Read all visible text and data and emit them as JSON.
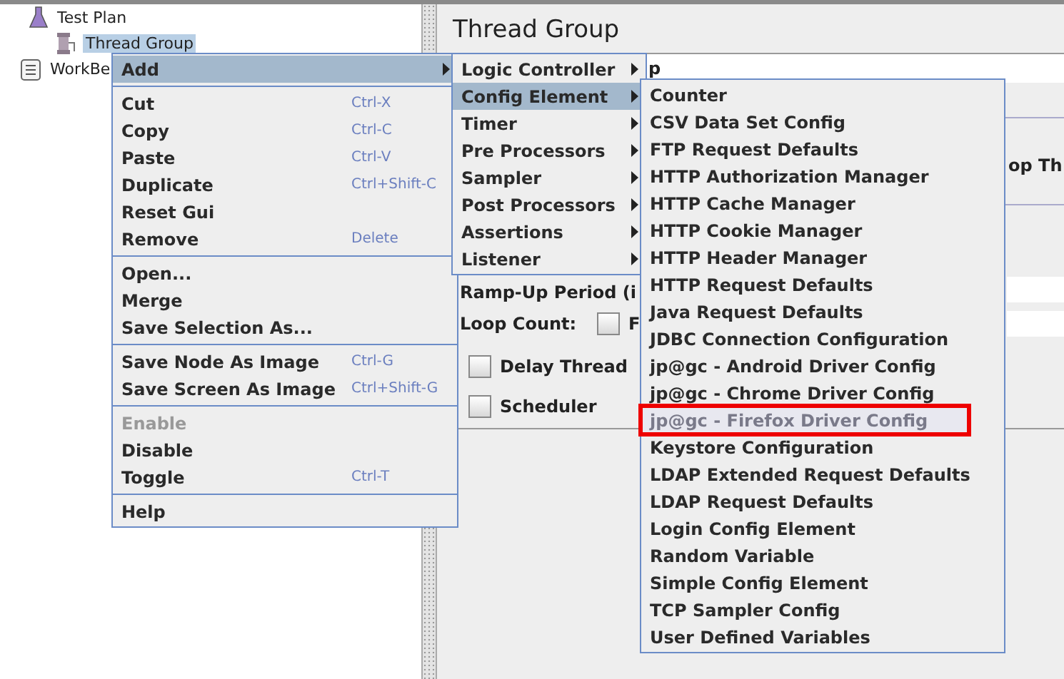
{
  "tree": {
    "items": [
      {
        "label": "Test Plan",
        "selected": false,
        "children": [
          {
            "label": "Thread Group",
            "selected": true
          }
        ]
      },
      {
        "label": "WorkBe",
        "selected": false
      }
    ]
  },
  "panel": {
    "title": "Thread Group",
    "name_value": "p",
    "action_text": "op Th",
    "rampup_label": "Ramp-Up Period (i",
    "loop_label": "Loop Count:",
    "forever": {
      "label": "F",
      "checked": false
    },
    "delay": {
      "label": "Delay Thread",
      "checked": false
    },
    "scheduler": {
      "label": "Scheduler",
      "checked": false
    }
  },
  "context_menu": {
    "items": [
      {
        "kind": "item",
        "label": "Add",
        "submenu": true,
        "selected": true,
        "disabled": false
      },
      {
        "kind": "separator"
      },
      {
        "kind": "item",
        "label": "Cut",
        "shortcut": "Ctrl-X",
        "submenu": false,
        "selected": false,
        "disabled": false
      },
      {
        "kind": "item",
        "label": "Copy",
        "shortcut": "Ctrl-C",
        "submenu": false,
        "selected": false,
        "disabled": false
      },
      {
        "kind": "item",
        "label": "Paste",
        "shortcut": "Ctrl-V",
        "submenu": false,
        "selected": false,
        "disabled": false
      },
      {
        "kind": "item",
        "label": "Duplicate",
        "shortcut": "Ctrl+Shift-C",
        "submenu": false,
        "selected": false,
        "disabled": false
      },
      {
        "kind": "item",
        "label": "Reset Gui",
        "submenu": false,
        "selected": false,
        "disabled": false
      },
      {
        "kind": "item",
        "label": "Remove",
        "shortcut": "Delete",
        "submenu": false,
        "selected": false,
        "disabled": false
      },
      {
        "kind": "separator"
      },
      {
        "kind": "item",
        "label": "Open...",
        "submenu": false,
        "selected": false,
        "disabled": false
      },
      {
        "kind": "item",
        "label": "Merge",
        "submenu": false,
        "selected": false,
        "disabled": false
      },
      {
        "kind": "item",
        "label": "Save Selection As...",
        "submenu": false,
        "selected": false,
        "disabled": false
      },
      {
        "kind": "separator"
      },
      {
        "kind": "item",
        "label": "Save Node As Image",
        "shortcut": "Ctrl-G",
        "submenu": false,
        "selected": false,
        "disabled": false
      },
      {
        "kind": "item",
        "label": "Save Screen As Image",
        "shortcut": "Ctrl+Shift-G",
        "submenu": false,
        "selected": false,
        "disabled": false
      },
      {
        "kind": "separator"
      },
      {
        "kind": "item",
        "label": "Enable",
        "submenu": false,
        "selected": false,
        "disabled": true
      },
      {
        "kind": "item",
        "label": "Disable",
        "submenu": false,
        "selected": false,
        "disabled": false
      },
      {
        "kind": "item",
        "label": "Toggle",
        "shortcut": "Ctrl-T",
        "submenu": false,
        "selected": false,
        "disabled": false
      },
      {
        "kind": "separator"
      },
      {
        "kind": "item",
        "label": "Help",
        "submenu": false,
        "selected": false,
        "disabled": false
      }
    ]
  },
  "add_menu": {
    "items": [
      {
        "label": "Logic Controller",
        "selected": false
      },
      {
        "label": "Config Element",
        "selected": true
      },
      {
        "label": "Timer",
        "selected": false
      },
      {
        "label": "Pre Processors",
        "selected": false
      },
      {
        "label": "Sampler",
        "selected": false
      },
      {
        "label": "Post Processors",
        "selected": false
      },
      {
        "label": "Assertions",
        "selected": false
      },
      {
        "label": "Listener",
        "selected": false
      }
    ]
  },
  "config_menu": {
    "items": [
      {
        "label": "Counter",
        "disabled": false,
        "annotated": false
      },
      {
        "label": "CSV Data Set Config",
        "disabled": false,
        "annotated": false
      },
      {
        "label": "FTP Request Defaults",
        "disabled": false,
        "annotated": false
      },
      {
        "label": "HTTP Authorization Manager",
        "disabled": false,
        "annotated": false
      },
      {
        "label": "HTTP Cache Manager",
        "disabled": false,
        "annotated": false
      },
      {
        "label": "HTTP Cookie Manager",
        "disabled": false,
        "annotated": false
      },
      {
        "label": "HTTP Header Manager",
        "disabled": false,
        "annotated": false
      },
      {
        "label": "HTTP Request Defaults",
        "disabled": false,
        "annotated": false
      },
      {
        "label": "Java Request Defaults",
        "disabled": false,
        "annotated": false
      },
      {
        "label": "JDBC Connection Configuration",
        "disabled": false,
        "annotated": false
      },
      {
        "label": "jp@gc - Android Driver Config",
        "disabled": false,
        "annotated": false
      },
      {
        "label": "jp@gc - Chrome Driver Config",
        "disabled": false,
        "annotated": false
      },
      {
        "label": "jp@gc - Firefox Driver Config",
        "disabled": true,
        "annotated": true
      },
      {
        "label": "Keystore Configuration",
        "disabled": false,
        "annotated": false
      },
      {
        "label": "LDAP Extended Request Defaults",
        "disabled": false,
        "annotated": false
      },
      {
        "label": "LDAP Request Defaults",
        "disabled": false,
        "annotated": false
      },
      {
        "label": "Login Config Element",
        "disabled": false,
        "annotated": false
      },
      {
        "label": "Random Variable",
        "disabled": false,
        "annotated": false
      },
      {
        "label": "Simple Config Element",
        "disabled": false,
        "annotated": false
      },
      {
        "label": "TCP Sampler Config",
        "disabled": false,
        "annotated": false
      },
      {
        "label": "User Defined Variables",
        "disabled": false,
        "annotated": false
      }
    ]
  }
}
